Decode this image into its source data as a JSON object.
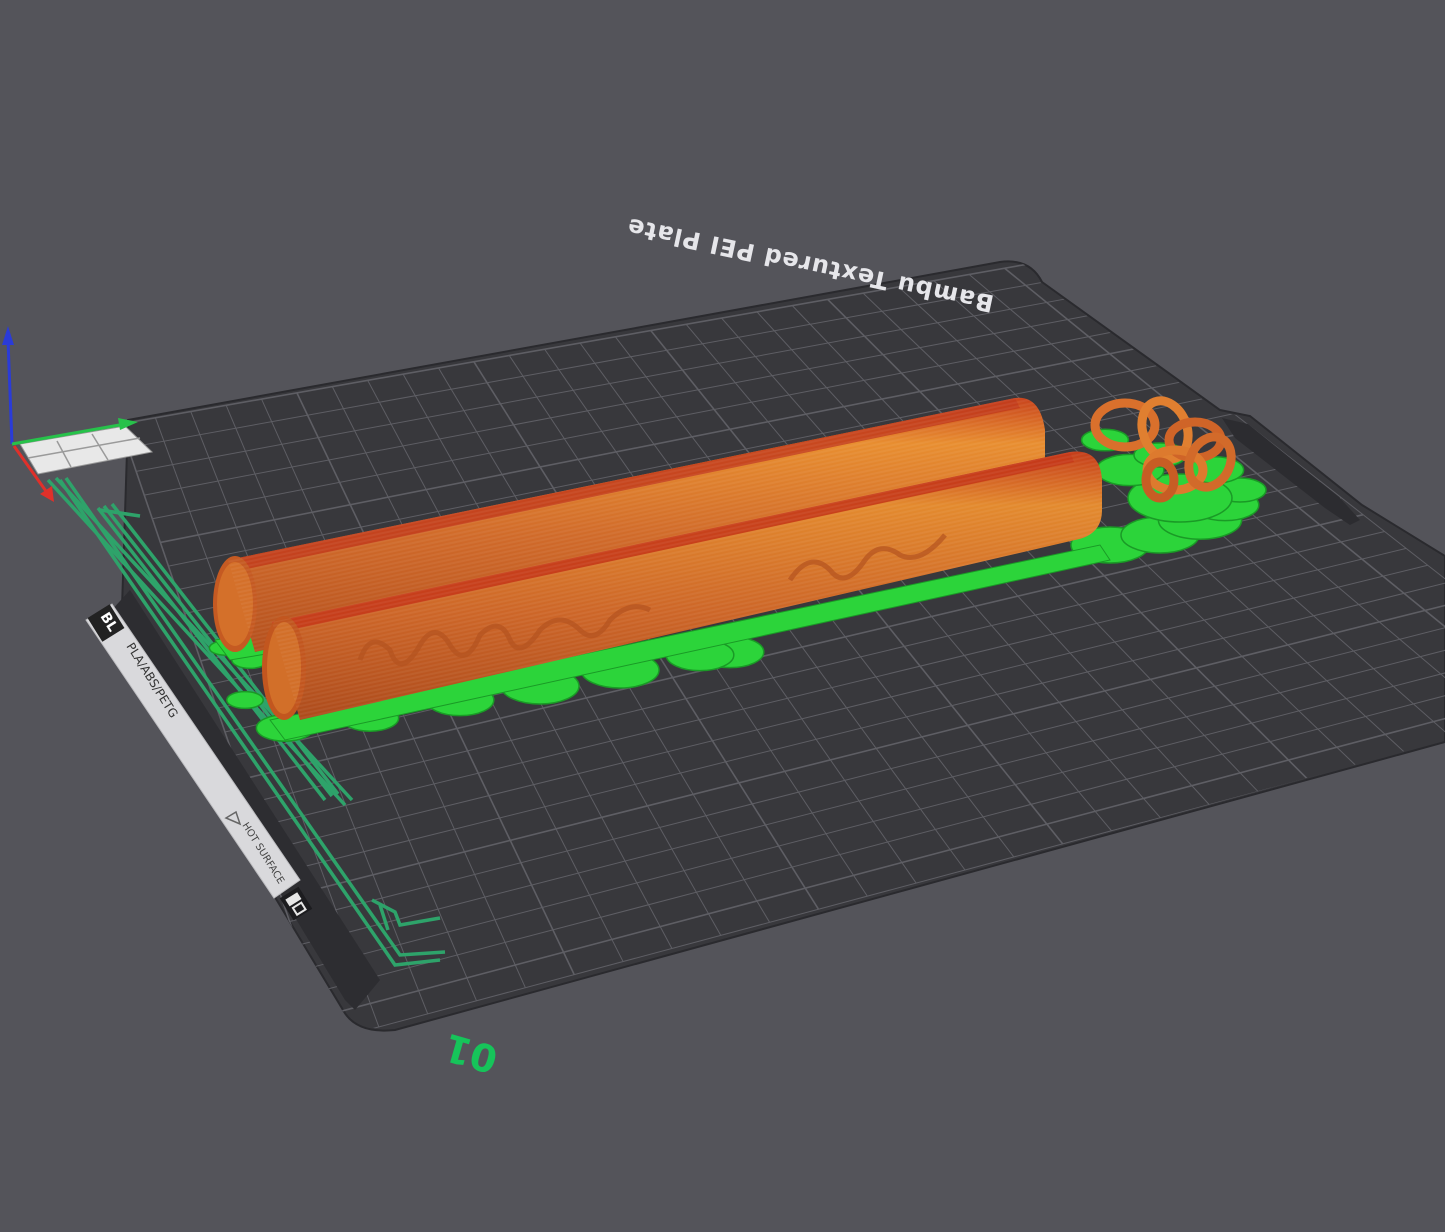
{
  "viewport": {
    "background": "#54545a",
    "plate": {
      "name": "Bambu Textured PEI Plate",
      "surface_color": "#38383c",
      "grid_color": "#5e5e64",
      "plate_number": "01"
    },
    "plate_label": {
      "brand": "BL",
      "materials": "PLA/ABS/PETG",
      "warning": "HOT SURFACE"
    },
    "colors": {
      "model": "#d06a2a",
      "model_highlight": "#e2892f",
      "model_shade": "#b94a1f",
      "support": "#2cd43a",
      "support_dark": "#1a9a26",
      "purge_line": "#2ea36a",
      "axis_x": "#e0302a",
      "axis_y": "#27c24a",
      "axis_z": "#2a3bd8",
      "plate_number": "#16c45a"
    },
    "axes": [
      "x-axis",
      "y-axis",
      "z-axis"
    ]
  }
}
